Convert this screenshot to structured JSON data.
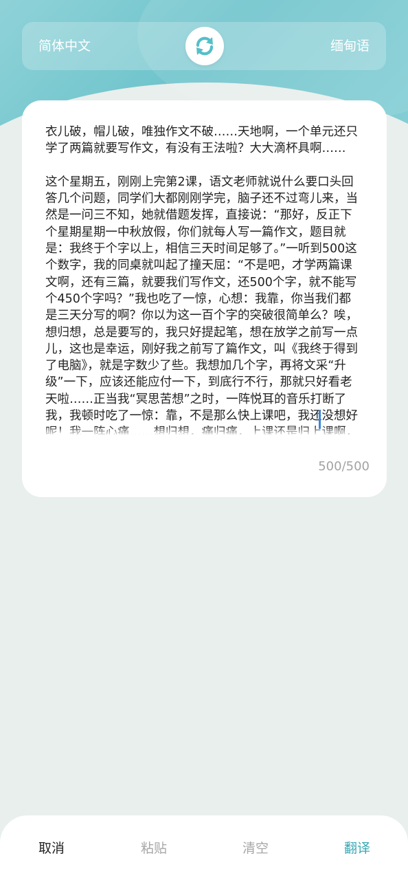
{
  "header": {
    "source_lang": "简体中文",
    "target_lang": "缅甸语",
    "swap_icon": "swap-refresh-icon"
  },
  "editor": {
    "text": "衣儿破，帽儿破，唯独作文不破……天地啊，一个单元还只学了两篇就要写作文，有没有王法啦？大大滴杯具啊……\n\n这个星期五，刚刚上完第2课，语文老师就说什么要口头回答几个问题，同学们大都刚刚学完，脑子还不过弯儿来，当然是一问三不知，她就借题发挥，直接说：“那好，反正下个星期星期一中秋放假，你们就每人写一篇作文，题目就是：我终于个字以上，相信三天时间足够了。”一听到500这个数字，我的同桌就叫起了撞天屈：“不是吧，才学两篇课文啊，还有三篇，就要我们写作文，还500个字，就不能写个450个字吗？”我也吃了一惊，心想：我靠，你当我们都是三天分写的啊？你以为这一百个字的突破很简单么？唉，想归想，总是要写的，我只好提起笔，想在放学之前写一点儿，这也是幸运，刚好我之前写了篇作文，叫《我终于得到了电脑》，就是字数少了些。我想加几个字，再将文采“升级”一下，应该还能应付一下，到底行不行，那就只好看老天啦……正当我“冥思苦想”之时，一阵悦耳的音乐打断了我，我顿时吃了一惊：靠，不是那么快上课吧，我还没想好呢！我一阵心痛……想归想，痛归痛，上课还是归上课啊，好不容易熬到了下课，却还要做作业",
    "counter": "500/500"
  },
  "bottom_bar": {
    "cancel": "取消",
    "paste": "粘贴",
    "clear": "清空",
    "translate": "翻译"
  },
  "colors": {
    "accent": "#3aa7b3",
    "header_gradient": "#6fc4cc",
    "background": "#e8efec",
    "disabled_text": "#a7a7a7"
  }
}
